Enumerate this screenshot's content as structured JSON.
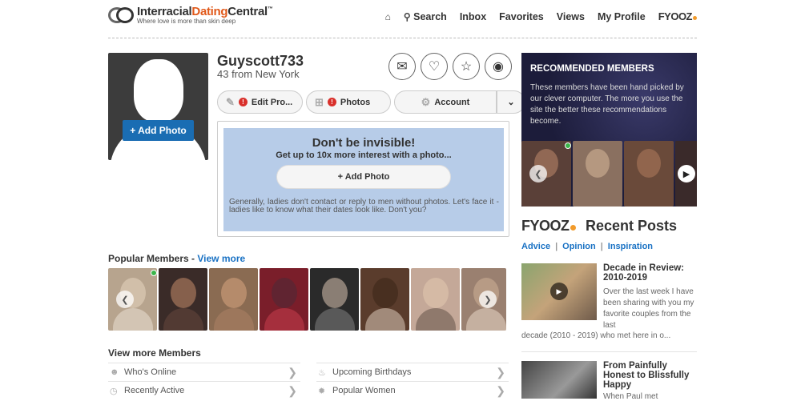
{
  "brand": {
    "name_a": "Interracial",
    "name_b": "Dating",
    "name_c": "Central",
    "tm": "™",
    "tagline": "Where love is more than skin deep"
  },
  "nav": {
    "search": "Search",
    "inbox": "Inbox",
    "favorites": "Favorites",
    "views": "Views",
    "my_profile": "My Profile",
    "fyooz": "FYOOZ"
  },
  "profile": {
    "username": "Guyscott733",
    "location": "43 from New York",
    "add_photo": "+ Add Photo",
    "edit_profile": "Edit Pro...",
    "photos": "Photos",
    "account": "Account"
  },
  "invisible": {
    "title": "Don't be invisible!",
    "subtitle": "Get up to 10x more interest with a photo...",
    "button": "+ Add Photo",
    "note": "Generally, ladies don't contact or reply to men without photos. Let's face it - ladies like to know what their dates look like. Don't you?"
  },
  "popular": {
    "title": "Popular Members - ",
    "view_more": "View more"
  },
  "more_members": {
    "title": "View more Members",
    "items": [
      "Who's Online",
      "Upcoming Birthdays",
      "Recently Active",
      "Popular Women"
    ]
  },
  "recommended": {
    "title": "RECOMMENDED MEMBERS",
    "text": "These members have been hand picked by our clever computer. The more you use the site the better these recommendations become."
  },
  "recent_posts": {
    "fyooz": "FYOOZ",
    "title": "Recent Posts",
    "tags": [
      "Advice",
      "Opinion",
      "Inspiration"
    ],
    "posts": [
      {
        "title": "Decade in Review: 2010-2019",
        "text": "Over the last week I have been sharing with you my favorite couples from the last",
        "tail": "decade (2010 - 2019) who met here in o..."
      },
      {
        "title": "From Painfully Honest to Blissfully Happy",
        "text": "When Paul met"
      }
    ]
  },
  "colors": {
    "accent": "#1a72c4",
    "brand_orange": "#e1591a",
    "online": "#3bb54a",
    "alert": "#d9302b"
  }
}
